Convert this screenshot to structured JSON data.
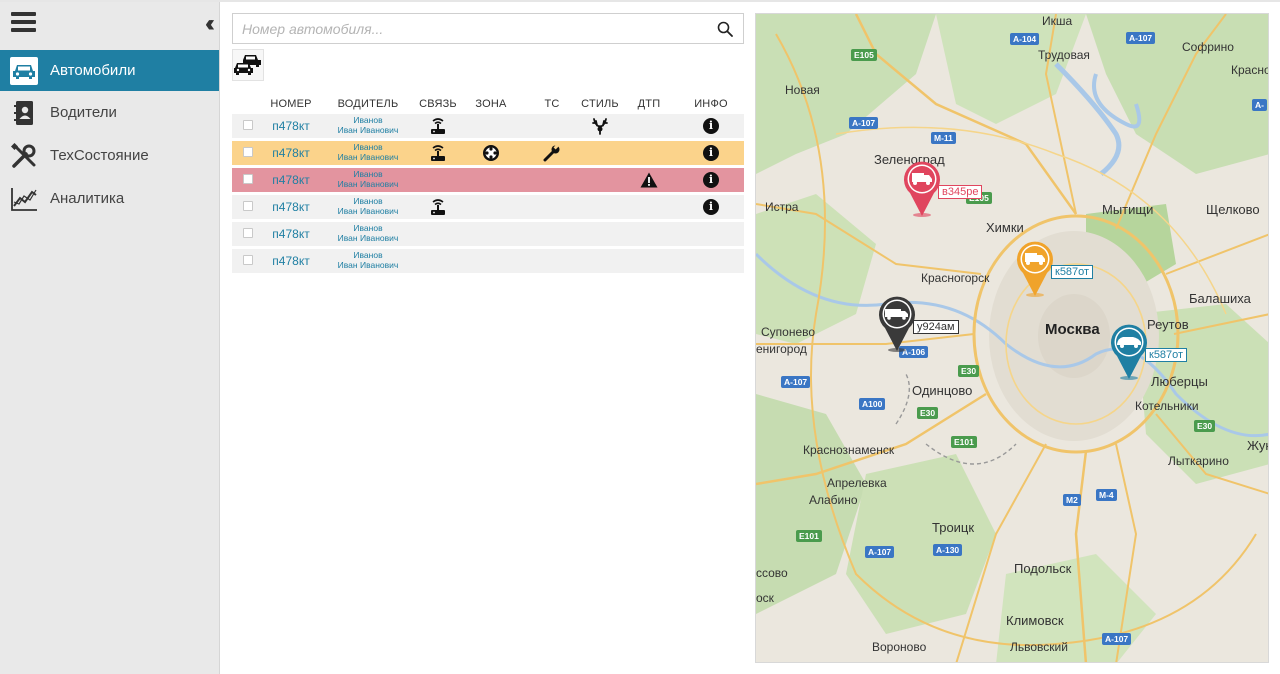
{
  "sidebar": {
    "items": [
      {
        "label": "Автомобили",
        "icon": "car-icon"
      },
      {
        "label": "Водители",
        "icon": "contacts-book-icon"
      },
      {
        "label": "ТехСостояние",
        "icon": "wrench-screwdriver-icon"
      },
      {
        "label": "Аналитика",
        "icon": "chart-line-icon"
      }
    ]
  },
  "search": {
    "placeholder": "Номер автомобиля..."
  },
  "table": {
    "headers": [
      "НОМЕР",
      "ВОДИТЕЛЬ",
      "СВЯЗЬ",
      "ЗОНА",
      "ТС",
      "СТИЛЬ",
      "ДТП",
      "ИНФО"
    ],
    "rows": [
      {
        "plate": "п478кт",
        "driver_last": "Иванов",
        "driver_full": "Иван Иванович",
        "status": "normal",
        "icons": [
          "router-icon",
          "",
          "",
          "antlers-icon",
          "",
          "info-icon"
        ]
      },
      {
        "plate": "п478кт",
        "driver_last": "Иванов",
        "driver_full": "Иван Иванович",
        "status": "warning",
        "icons": [
          "router-icon",
          "zone-target-icon",
          "wrench-icon",
          "",
          "",
          "info-icon"
        ]
      },
      {
        "plate": "п478кт",
        "driver_last": "Иванов",
        "driver_full": "Иван Иванович",
        "status": "danger",
        "icons": [
          "",
          "",
          "",
          "",
          "warning-triangle-icon",
          "info-icon"
        ]
      },
      {
        "plate": "п478кт",
        "driver_last": "Иванов",
        "driver_full": "Иван Иванович",
        "status": "normal",
        "icons": [
          "router-icon",
          "",
          "",
          "",
          "",
          "info-icon"
        ]
      },
      {
        "plate": "п478кт",
        "driver_last": "Иванов",
        "driver_full": "Иван Иванович",
        "status": "normal",
        "icons": [
          "",
          "",
          "",
          "",
          "",
          ""
        ]
      },
      {
        "plate": "п478кт",
        "driver_last": "Иванов",
        "driver_full": "Иван Иванович",
        "status": "normal",
        "icons": [
          "",
          "",
          "",
          "",
          "",
          ""
        ]
      }
    ],
    "info_glyph": "i"
  },
  "map": {
    "cities": [
      {
        "name": "Зеленоград",
        "size": "mid"
      },
      {
        "name": "Химки",
        "size": "mid"
      },
      {
        "name": "Мытищи",
        "size": "mid"
      },
      {
        "name": "Щелково",
        "size": "mid"
      },
      {
        "name": "Красногорск",
        "size": "normal"
      },
      {
        "name": "Москва",
        "size": "big"
      },
      {
        "name": "Балашиха",
        "size": "mid"
      },
      {
        "name": "Реутов",
        "size": "mid"
      },
      {
        "name": "Люберцы",
        "size": "mid"
      },
      {
        "name": "Одинцово",
        "size": "mid"
      },
      {
        "name": "Котельники",
        "size": "normal"
      },
      {
        "name": "Жуков",
        "size": "mid"
      },
      {
        "name": "Лыткарино",
        "size": "normal"
      },
      {
        "name": "Краснознаменск",
        "size": "normal"
      },
      {
        "name": "Апрелевка",
        "size": "normal"
      },
      {
        "name": "Алабино",
        "size": "normal"
      },
      {
        "name": "Троицк",
        "size": "mid"
      },
      {
        "name": "Подольск",
        "size": "mid"
      },
      {
        "name": "Климовск",
        "size": "mid"
      },
      {
        "name": "Вороново",
        "size": "normal"
      },
      {
        "name": "Львовский",
        "size": "normal"
      },
      {
        "name": "Истра",
        "size": "normal"
      },
      {
        "name": "Новая",
        "size": "normal"
      },
      {
        "name": "Икша",
        "size": "normal"
      },
      {
        "name": "Трудовая",
        "size": "normal"
      },
      {
        "name": "Софрино",
        "size": "normal"
      },
      {
        "name": "Красно",
        "size": "normal"
      },
      {
        "name": "Супонево",
        "size": "normal"
      },
      {
        "name": "енигород",
        "size": "normal"
      },
      {
        "name": "ссово",
        "size": "normal"
      },
      {
        "name": "оск",
        "size": "normal"
      }
    ],
    "roads": [
      "A-104",
      "A-107",
      "E105",
      "A-107",
      "M-11",
      "E105",
      "A-106",
      "E30",
      "A-107",
      "A100",
      "E30",
      "E101",
      "E30",
      "M2",
      "M-4",
      "E101",
      "A-107",
      "A-130",
      "A-107",
      "A-"
    ],
    "vehicles": [
      {
        "label": "в345ре",
        "color": "#e0455e",
        "icon": "truck-icon"
      },
      {
        "label": "к587от",
        "color": "#f0a32b",
        "icon": "truck-icon"
      },
      {
        "label": "у924ам",
        "color": "#3a3a3a",
        "icon": "truck-icon"
      },
      {
        "label": "к587от",
        "color": "#1f7fa3",
        "icon": "car-icon"
      }
    ]
  }
}
